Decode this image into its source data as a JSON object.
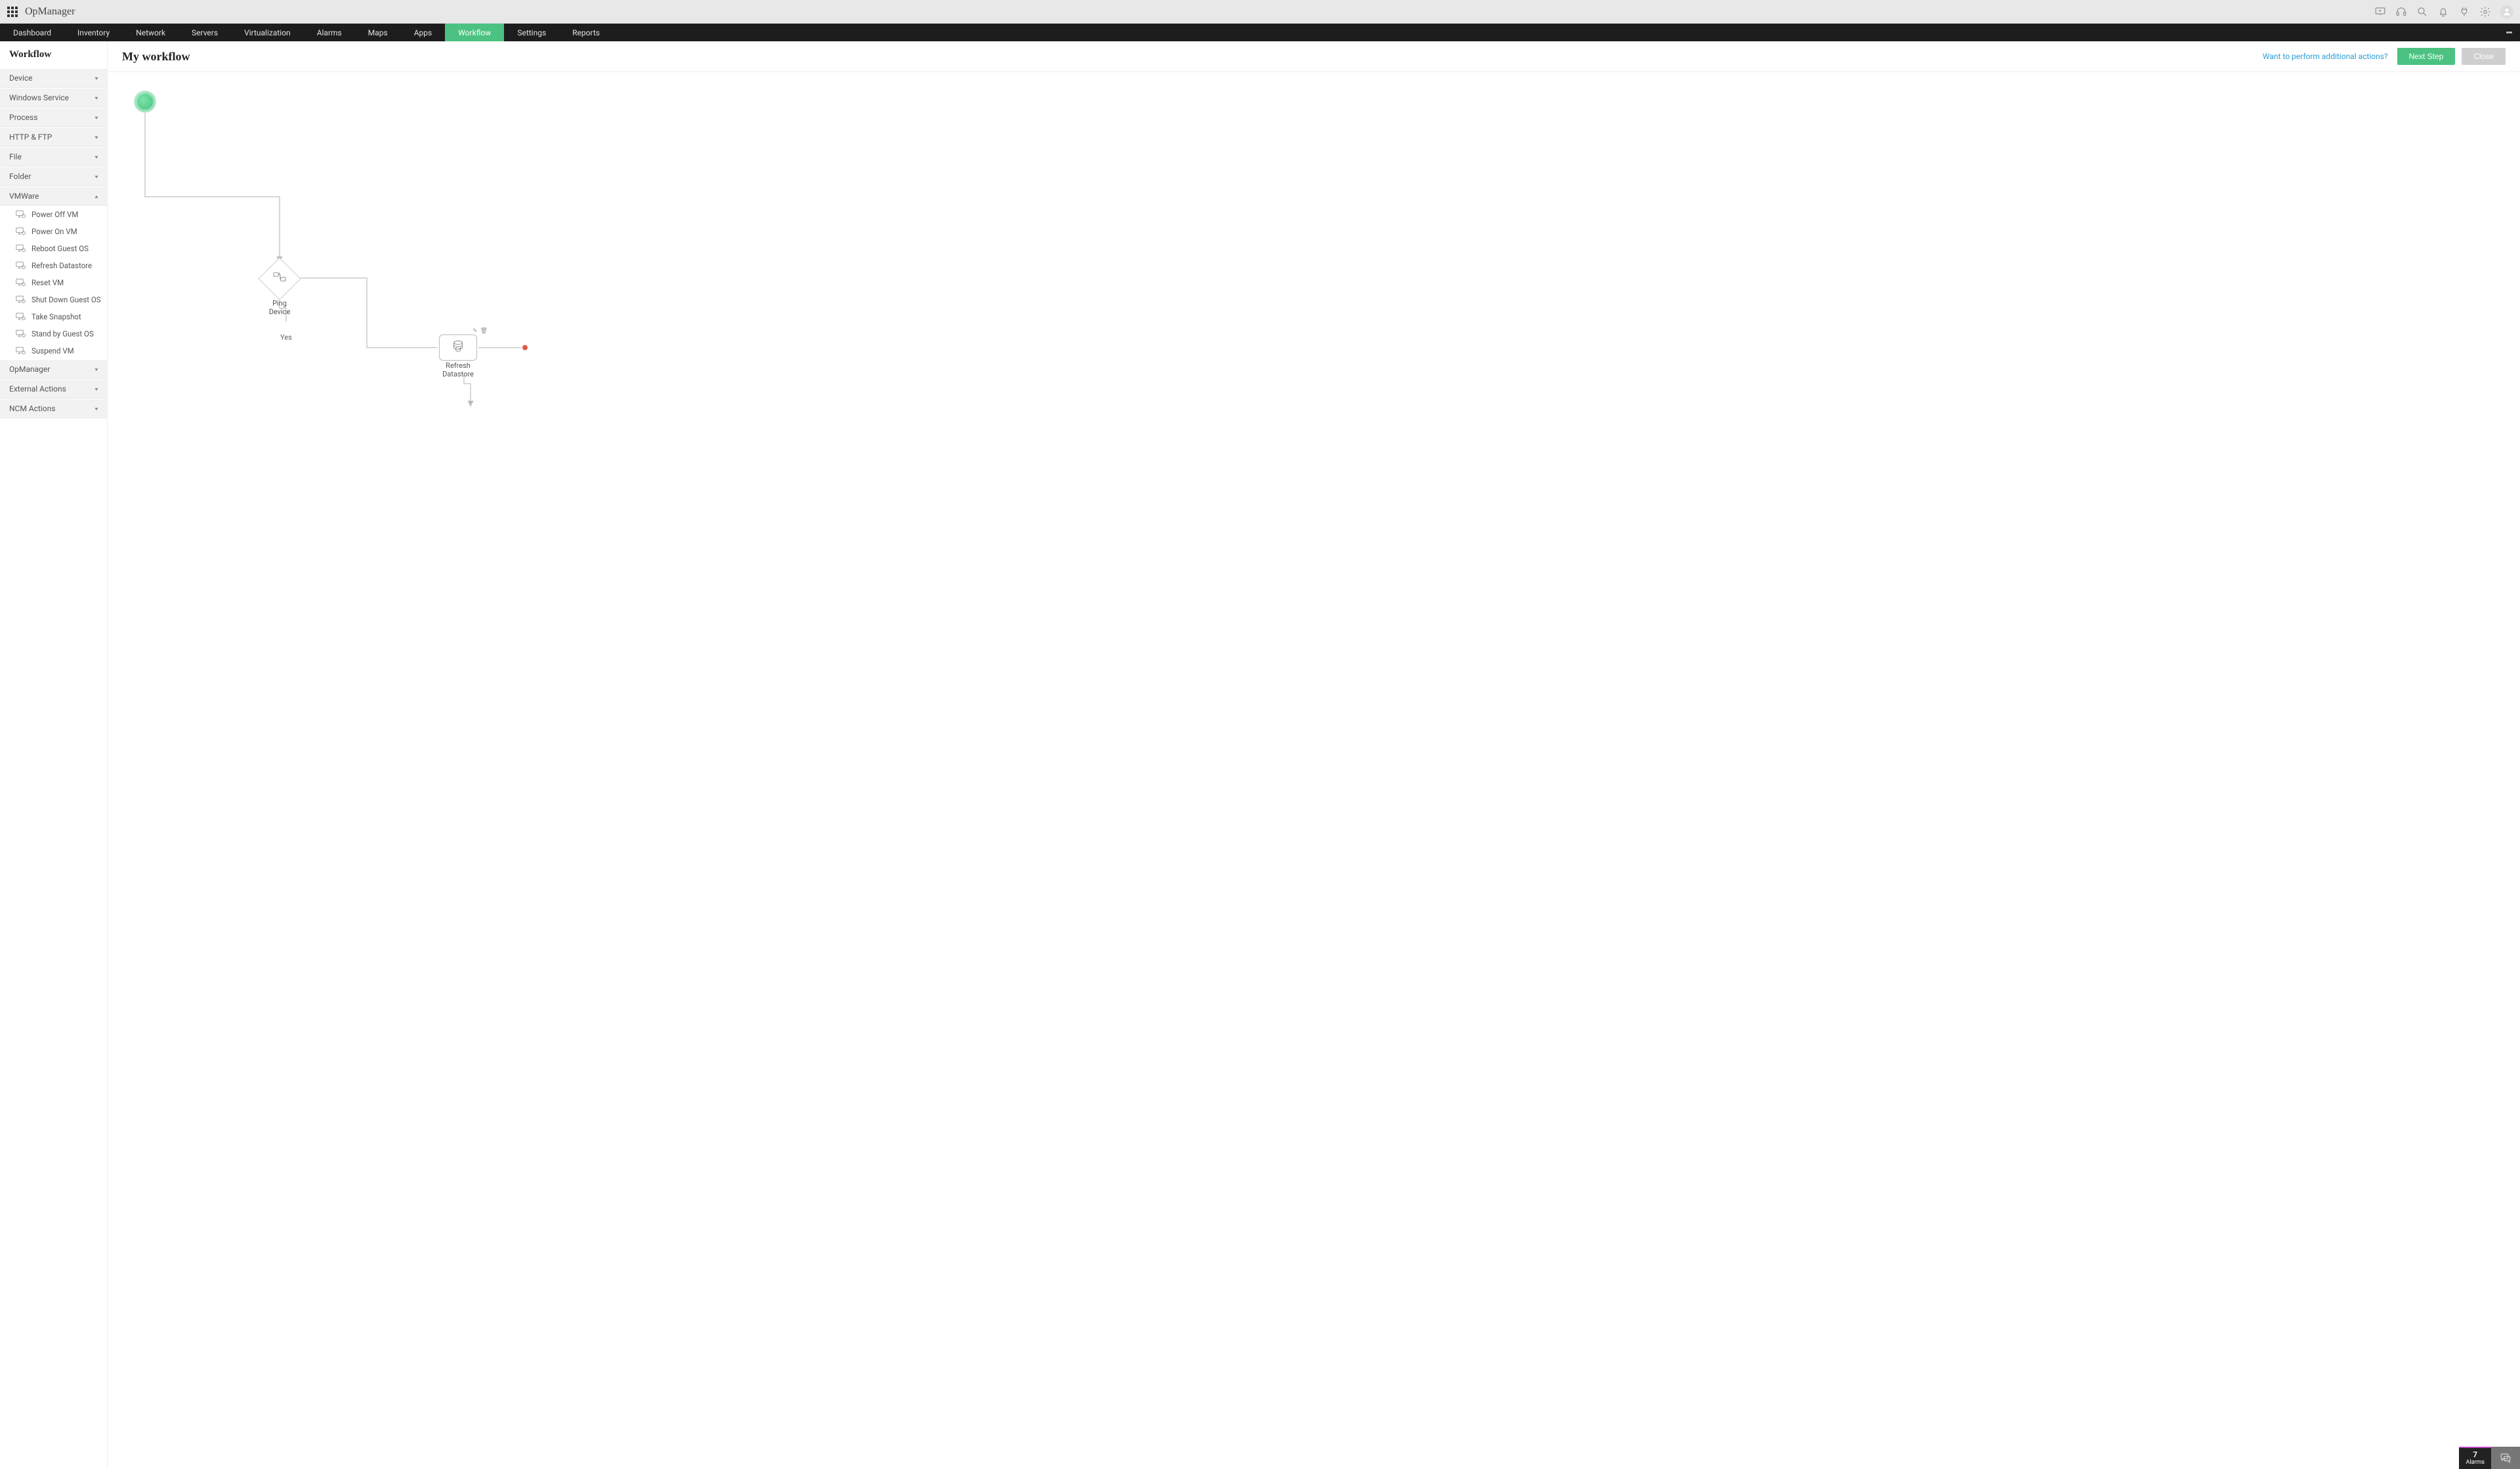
{
  "app": {
    "title": "OpManager"
  },
  "nav": {
    "items": [
      "Dashboard",
      "Inventory",
      "Network",
      "Servers",
      "Virtualization",
      "Alarms",
      "Maps",
      "Apps",
      "Workflow",
      "Settings",
      "Reports"
    ],
    "active": "Workflow"
  },
  "sidebar": {
    "title": "Workflow",
    "cats": [
      {
        "label": "Device",
        "open": false
      },
      {
        "label": "Windows Service",
        "open": false
      },
      {
        "label": "Process",
        "open": false
      },
      {
        "label": "HTTP & FTP",
        "open": false
      },
      {
        "label": "File",
        "open": false
      },
      {
        "label": "Folder",
        "open": false
      },
      {
        "label": "VMWare",
        "open": true,
        "items": [
          {
            "label": "Power Off VM"
          },
          {
            "label": "Power On VM"
          },
          {
            "label": "Reboot Guest OS"
          },
          {
            "label": "Refresh Datastore"
          },
          {
            "label": "Reset VM"
          },
          {
            "label": "Shut Down Guest OS"
          },
          {
            "label": "Take Snapshot"
          },
          {
            "label": "Stand by Guest OS"
          },
          {
            "label": "Suspend VM"
          }
        ]
      },
      {
        "label": "OpManager",
        "open": false
      },
      {
        "label": "External Actions",
        "open": false
      },
      {
        "label": "NCM Actions",
        "open": false
      }
    ]
  },
  "workflow": {
    "title": "My workflow",
    "help_link": "Want to perform additional actions?",
    "buttons": {
      "next": "Next Step",
      "close": "Close"
    },
    "nodes": {
      "decision": {
        "label_l1": "Ping",
        "label_l2": "Device",
        "yes": "Yes"
      },
      "activity": {
        "label_l1": "Refresh",
        "label_l2": "Datastore"
      }
    }
  },
  "dock": {
    "alarm_count": "7",
    "alarm_label": "Alarms"
  }
}
